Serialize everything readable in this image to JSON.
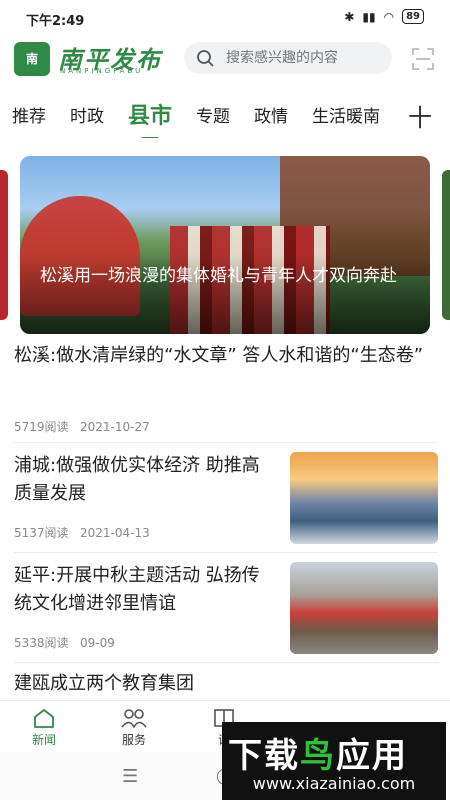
{
  "status": {
    "time": "下午2:49",
    "battery": "89"
  },
  "header": {
    "logo_badge": "南",
    "logo_text": "南平发布",
    "logo_sub": "NANPINGFABU",
    "search_placeholder": "搜索感兴趣的内容"
  },
  "tabs": [
    {
      "label": "推荐",
      "active": false
    },
    {
      "label": "时政",
      "active": false
    },
    {
      "label": "县市",
      "active": true
    },
    {
      "label": "专题",
      "active": false
    },
    {
      "label": "政情",
      "active": false
    },
    {
      "label": "生活暖南",
      "active": false
    }
  ],
  "tab_add": "十",
  "banner": {
    "caption": "松溪用一场浪漫的集体婚礼与青年人才双向奔赴"
  },
  "news": [
    {
      "title": "松溪:做水清岸绿的“水文章” 答人水和谐的“生态卷”",
      "reads": "5719阅读",
      "date": "2021-10-27"
    },
    {
      "title": "浦城:做强做优实体经济 助推高质量发展",
      "reads": "5137阅读",
      "date": "2021-04-13"
    },
    {
      "title": "延平:开展中秋主题活动 弘扬传统文化增进邻里情谊",
      "reads": "5338阅读",
      "date": "09-09"
    },
    {
      "title": "建瓯成立两个教育集团"
    }
  ],
  "bottom_nav": [
    {
      "label": "新闻",
      "icon": "home-icon",
      "active": true
    },
    {
      "label": "服务",
      "icon": "people-icon",
      "active": false
    },
    {
      "label": "读",
      "icon": "book-icon",
      "active": false
    }
  ],
  "watermark": {
    "brand_a": "下载",
    "brand_b": "鸟",
    "brand_c": "应用",
    "url": "www.xiazainiao.com"
  },
  "sysnav": {
    "menu": "☰",
    "home": "◯"
  },
  "colors": {
    "brand_green": "#2f8a45"
  }
}
